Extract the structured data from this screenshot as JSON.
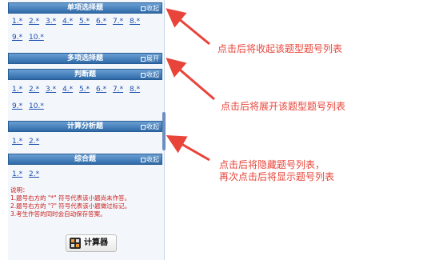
{
  "panel": {
    "sections": [
      {
        "title": "单项选择题",
        "toggle": "收起",
        "numbers": [
          "1.*",
          "2.*",
          "3.*",
          "4.*",
          "5.*",
          "6.*",
          "7.*",
          "8.*",
          "9.*",
          "10.*"
        ]
      },
      {
        "title": "多项选择题",
        "toggle": "展开",
        "numbers": []
      },
      {
        "title": "判断题",
        "toggle": "收起",
        "numbers": [
          "1.*",
          "2.*",
          "3.*",
          "4.*",
          "5.*",
          "6.*",
          "7.*",
          "8.*",
          "9.*",
          "10.*"
        ]
      },
      {
        "title": "计算分析题",
        "toggle": "收起",
        "numbers": [
          "1.*",
          "2.*"
        ]
      },
      {
        "title": "综合题",
        "toggle": "收起",
        "numbers": [
          "1.*",
          "2.*"
        ]
      }
    ],
    "notes": [
      "说明：",
      "1.题号右方的 \"*\" 符号代表该小题尚未作答。",
      "2.题号右方的 \"?\" 符号代表该小题做过标记。",
      "3.考生作答的同时会自动保存答案。"
    ],
    "calculator_label": "计算器"
  },
  "annotations": {
    "collapse": "点击后将收起该题型题号列表",
    "expand": "点击后将展开该题型题号列表",
    "toggle_line1": "点击后将隐藏题号列表，",
    "toggle_line2": "再次点击后将显示题号列表"
  },
  "colors": {
    "header": "#3a78b8",
    "link": "#1b4fb0",
    "note": "#cc1e1e",
    "arrow": "#e8443a"
  }
}
